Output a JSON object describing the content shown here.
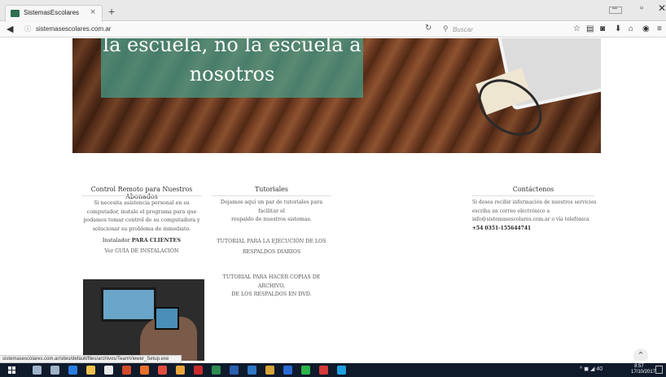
{
  "browser": {
    "tab_title": "SistemasEscolares",
    "tab_close": "×",
    "new_tab": "+",
    "url": "sistemasescolares.com.ar",
    "search_placeholder": "Buscar",
    "window_controls": {
      "minimize": "–",
      "maximize": "▫",
      "close": "✕"
    },
    "toolbar_icons": [
      "star-icon",
      "bookmarks-icon",
      "pocket-icon",
      "download-icon",
      "home-icon",
      "sync-icon",
      "menu-icon"
    ]
  },
  "hero": {
    "line1": "la escuela, no la escuela a",
    "line2": "nosotros"
  },
  "columns": {
    "remote": {
      "title": "Control Remoto para Nuestros Abonados",
      "text": [
        "Si necesita asistencia personal en su",
        "computador, instale el programa para que",
        "podamos tomar control de su computadora y",
        "solucionar su problema de inmediato."
      ],
      "installer_prefix": "Instalador",
      "installer_bold": "PARA CLIENTES",
      "guide_link": "Ver GUÍA DE INSTALACIÓN"
    },
    "tutorials": {
      "title": "Tutoriales",
      "text": [
        "Dejamos aquí un par de tutoriales para facilitar el",
        "respaldo de nuestros sistemas."
      ],
      "link1": [
        "TUTORIAL PARA LA EJECUCIÓN DE LOS",
        "RESPALDOS DIARIOS"
      ],
      "link2": [
        "TUTORIAL PARA HACER COPIAS DE ARCHIVO,",
        "DE LOS RESPALDOS EN DVD."
      ]
    },
    "contact": {
      "title": "Contáctenos",
      "text": [
        "Si desea recibir información de nuestros servicios",
        "escriba un correo electrónico a",
        "info@sistemasescolares.com.ar o vía telefónica"
      ],
      "phone": "+54 0351-155644741"
    }
  },
  "status_bar": "sistemasescolares.com.ar/sites/default/files/archivos/TeamViewer_Setup.exe",
  "taskbar": {
    "apps": [
      {
        "name": "search",
        "color": "#9fb3c8"
      },
      {
        "name": "task-view",
        "color": "#9fb3c8"
      },
      {
        "name": "edge",
        "color": "#2b7de0"
      },
      {
        "name": "file-explorer",
        "color": "#f2c14b"
      },
      {
        "name": "store",
        "color": "#e8e8e8"
      },
      {
        "name": "powerpoint",
        "color": "#d04a2b"
      },
      {
        "name": "firefox",
        "color": "#e8702a"
      },
      {
        "name": "chrome",
        "color": "#e04e3e"
      },
      {
        "name": "photoshop",
        "color": "#e8a63a"
      },
      {
        "name": "filezilla",
        "color": "#c92b2b"
      },
      {
        "name": "paint",
        "color": "#2d8a4e"
      },
      {
        "name": "word",
        "color": "#2a5fb0"
      },
      {
        "name": "chart",
        "color": "#2f78c4"
      },
      {
        "name": "folder",
        "color": "#d7a43a"
      },
      {
        "name": "teamviewer",
        "color": "#2a6bd6"
      },
      {
        "name": "whatsapp",
        "color": "#2bb34a"
      },
      {
        "name": "opera",
        "color": "#d63a3a"
      },
      {
        "name": "skype",
        "color": "#1fa0e0"
      }
    ],
    "tray": "^ ◼ ◢ 40",
    "time": "8:57",
    "date": "17/10/2017"
  }
}
